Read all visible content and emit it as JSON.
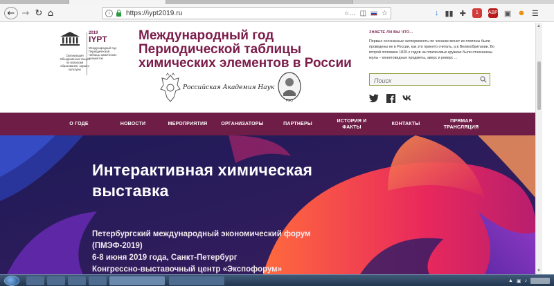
{
  "browser": {
    "url": "https://iypt2019.ru",
    "toolbar_badge_count": "1",
    "nav_icons": [
      "back-icon",
      "forward-icon",
      "reload-icon",
      "home-icon"
    ],
    "ext_icons": [
      "pocket-icon",
      "reader-icon",
      "flag-ru-icon",
      "star-icon"
    ],
    "right_icons": [
      "download-icon",
      "library-icon",
      "eyedropper-icon",
      "extension-icon",
      "abp-icon",
      "addon-icon",
      "face-icon",
      "menu-icon"
    ]
  },
  "header": {
    "unesco_text": "Организация Объединённых Наций по вопросам образования, науки и культуры",
    "iypt_logo": "IYPT",
    "iypt_year": "2019",
    "iypt_text": "Международный год Периодической таблицы химических элементов",
    "title_line1": "Международный год",
    "title_line2": "Периодической таблицы",
    "title_line3": "химических элементов в России",
    "academy_text": "Российская Академия Наук",
    "rho_text": "РХО"
  },
  "did_you_know": {
    "heading": "ЗНАЕТЕ ЛИ ВЫ ЧТО...",
    "text": "Первые осознанные эксперименты по чеканке монет из платины были проведены не в России, как это принято считать, а в Великобритании. Во второй половине 1820-х годов на платиновых кружках были отчеканены мулы – монетовидные предметы, аверс и реверс ..."
  },
  "search": {
    "placeholder": "Поиск"
  },
  "social": [
    "twitter-icon",
    "facebook-icon",
    "vk-icon"
  ],
  "nav": [
    {
      "label": "О ГОДЕ"
    },
    {
      "label": "НОВОСТИ"
    },
    {
      "label": "МЕРОПРИЯТИЯ"
    },
    {
      "label": "ОРГАНИЗАТОРЫ"
    },
    {
      "label": "ПАРТНЕРЫ"
    },
    {
      "label": "ИСТОРИЯ И ФАКТЫ"
    },
    {
      "label": "КОНТАКТЫ"
    },
    {
      "label": "ПРЯМАЯ ТРАНСЛЯЦИЯ"
    }
  ],
  "hero": {
    "title_line1": "Интерактивная химическая",
    "title_line2": "выставка",
    "line1": "Петербургский международный экономический форум",
    "line2": "(ПМЭФ-2019)",
    "line3": "6-8 июня 2019 года, Санкт-Петербург",
    "line4": "Конгрессно-выставочный центр «Экспофорум»"
  },
  "colors": {
    "brand": "#6e1d46",
    "title": "#7b1c4a",
    "search_border": "#8fa23f",
    "hero_bg": "#221a53"
  }
}
